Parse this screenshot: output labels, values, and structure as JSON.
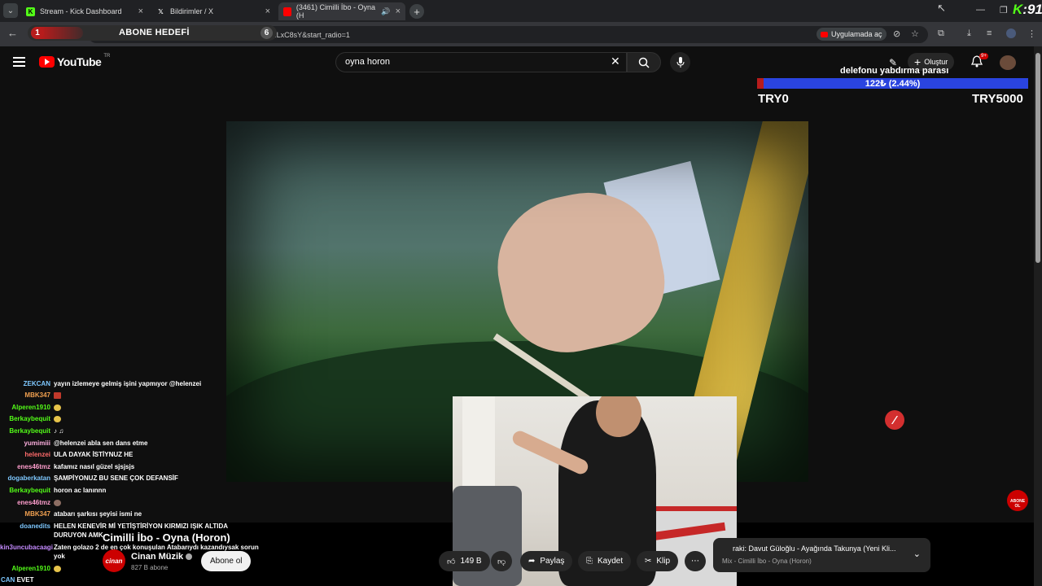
{
  "browser": {
    "tabs": [
      {
        "title": "Stream - Kick Dashboard",
        "icon": "kick-icon"
      },
      {
        "title": "Bildirimler / X",
        "icon": "x-icon"
      },
      {
        "title": "(3461) Cimilli İbo - Oyna (H",
        "icon": "youtube-icon"
      }
    ],
    "url": "youtube.com/watch?v=...UdWlLxC8sY&list=RDh...WlLxC8sY&start_radio=1",
    "open_in_app": "Uygulamada aç"
  },
  "stream_overlay": {
    "subscriber_goal": {
      "current": "1",
      "label": "ABONE HEDEFİ",
      "target": "6"
    },
    "donation_goal": {
      "title": "delefonu yabdırma parası",
      "progress_text": "122₺ (2.44%)",
      "progress_fraction": 0.0244,
      "min_label": "TRY0",
      "max_label": "TRY5000"
    },
    "subscribe_badge": "ABONE OL"
  },
  "youtube": {
    "logo_text": "YouTube",
    "region": "TR",
    "search_query": "oyna horon",
    "create_label": "Oluştur",
    "notification_count": "9+",
    "video_title": "Cimilli İbo - Oyna (Horon)",
    "channel_name": "Cinan Müzik",
    "channel_logo_text": "cinan",
    "channel_subs": "827 B abone",
    "subscribe_label": "Abone ol",
    "likes": "149 B",
    "share_label": "Paylaş",
    "save_label": "Kaydet",
    "clip_label": "Klip",
    "next_up_title": "raki: Davut Güloğlu - Ayağında Takunya (Yeni Kli...",
    "next_up_subtitle": "Mix - Cimilli İbo - Oyna (Horon)"
  },
  "chat": [
    {
      "user": "ZEKCAN",
      "color": "#7ec8ff",
      "text": "yayın izlemeye gelmiş işini yapmıyor @helenzei"
    },
    {
      "user": "MBK347",
      "color": "#f0a050",
      "text": ""
    },
    {
      "user": "Alperen1910",
      "color": "#53fc18",
      "text": ""
    },
    {
      "user": "Berkaybequit",
      "color": "#53fc18",
      "text": ""
    },
    {
      "user": "Berkaybequit",
      "color": "#53fc18",
      "text": ""
    },
    {
      "user": "yumimiii",
      "color": "#ffb0e0",
      "text": "@helenzei abla sen dans etme"
    },
    {
      "user": "helenzei",
      "color": "#ff6b6b",
      "text": "ULA DAYAK İSTİYNUZ HE"
    },
    {
      "user": "enes46tmz",
      "color": "#ff9ecd",
      "text": "kafamız nasıl güzel sjsjsjs"
    },
    {
      "user": "dogaberkatan",
      "color": "#7ec8ff",
      "text": "ŞAMPİYONUZ BU SENE ÇOK DEFANSİF"
    },
    {
      "user": "Berkaybequit",
      "color": "#53fc18",
      "text": "horon ac lanınnn"
    },
    {
      "user": "enes46tmz",
      "color": "#ff9ecd",
      "text": ""
    },
    {
      "user": "MBK347",
      "color": "#f0a050",
      "text": "atabarı şarkısı şeyisi ismi ne"
    },
    {
      "user": "doanedits",
      "color": "#7ec8ff",
      "text": "HELEN KENEVİR Mİ YETİŞTİRİYON KIRMIZI IŞIK ALTIDA"
    },
    {
      "user": "",
      "color": "#fff",
      "text": "DURUYON AMK"
    },
    {
      "user": "kin3uncubacaagi",
      "color": "#c58bff",
      "text": "Zaten golazo 2 de en çok konuşulan Atabarıydı kazandıysak sorun"
    },
    {
      "user": "",
      "color": "#fff",
      "text": "yok"
    },
    {
      "user": "Alperen1910",
      "color": "#53fc18",
      "text": ""
    },
    {
      "user": "CAN",
      "color": "#7ec8ff",
      "text": "EVET"
    }
  ]
}
